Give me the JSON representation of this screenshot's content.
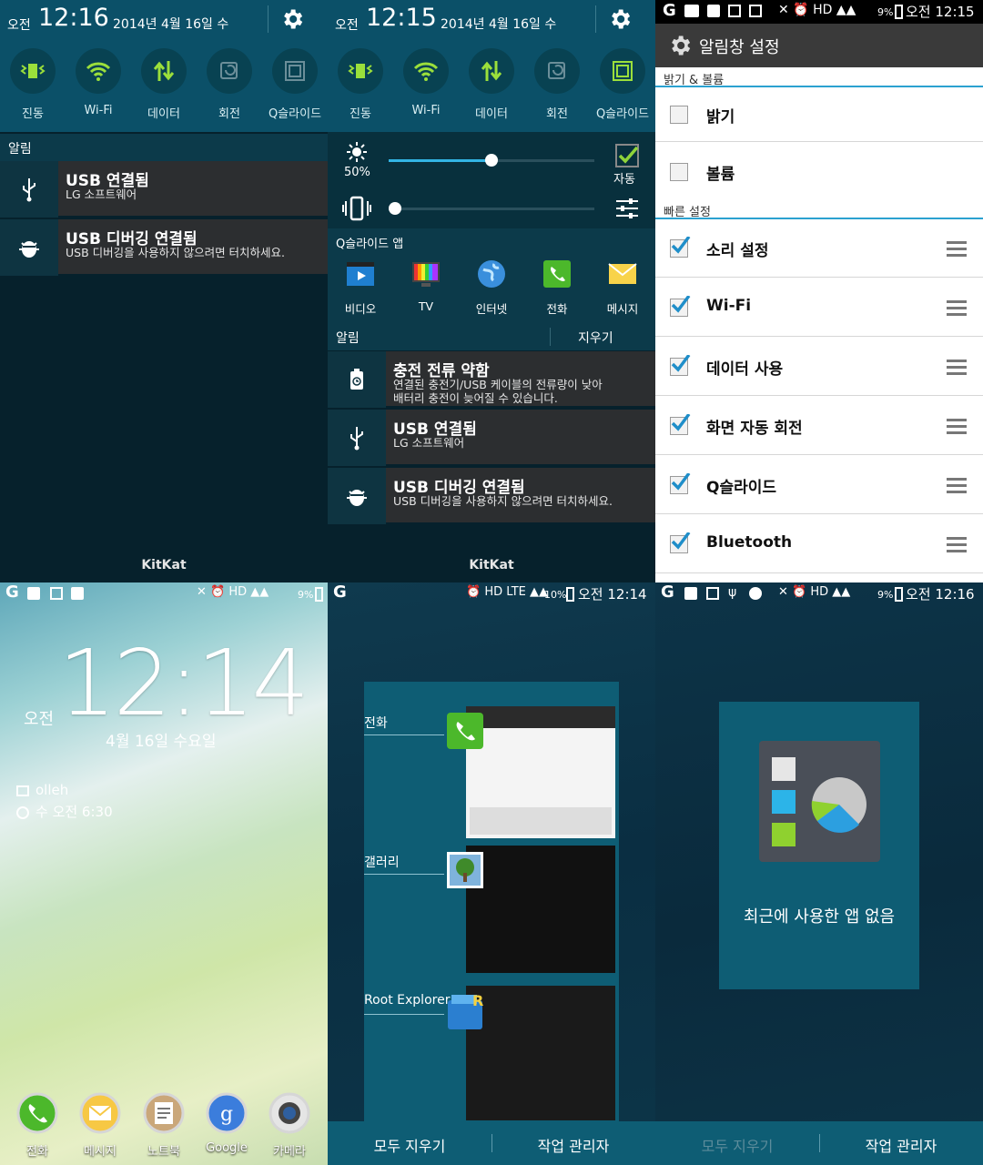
{
  "notif1": {
    "ampm": "오전",
    "time": "12:16",
    "date": "2014년 4월 16일 수",
    "quick": [
      "진동",
      "Wi-Fi",
      "데이터",
      "회전",
      "Q슬라이드"
    ],
    "section": "알림",
    "items": [
      {
        "title": "USB 연결됨",
        "sub": "LG 소프트웨어"
      },
      {
        "title": "USB 디버깅 연결됨",
        "sub": "USB 디버깅을 사용하지 않으려면 터치하세요."
      }
    ],
    "footer": "KitKat"
  },
  "notif2": {
    "ampm": "오전",
    "time": "12:15",
    "date": "2014년 4월 16일 수",
    "quick": [
      "진동",
      "Wi-Fi",
      "데이터",
      "회전",
      "Q슬라이드"
    ],
    "brightness_pct": "50%",
    "brightness_level": 0.5,
    "volume_level": 0.0,
    "auto": "자동",
    "qslide_title": "Q슬라이드 앱",
    "qslide_apps": [
      "비디오",
      "TV",
      "인터넷",
      "전화",
      "메시지"
    ],
    "section": "알림",
    "clear": "지우기",
    "items": [
      {
        "title": "충전 전류 약함",
        "sub": "연결된 충전기/USB 케이블의 전류량이 낮아\n배터리 충전이 늦어질 수 있습니다."
      },
      {
        "title": "USB 연결됨",
        "sub": "LG 소프트웨어"
      },
      {
        "title": "USB 디버깅 연결됨",
        "sub": "USB 디버깅을 사용하지 않으려면 터치하세요."
      }
    ],
    "footer": "KitKat"
  },
  "settings": {
    "status_time": "오전 12:15",
    "battery": "9%",
    "title": "알림창 설정",
    "sections": [
      {
        "header": "밝기 & 볼륨",
        "items": [
          {
            "label": "밝기",
            "checked": false
          },
          {
            "label": "볼륨",
            "checked": false
          }
        ]
      },
      {
        "header": "빠른 설정",
        "items": [
          {
            "label": "소리 설정",
            "checked": true
          },
          {
            "label": "Wi-Fi",
            "checked": true
          },
          {
            "label": "데이터 사용",
            "checked": true
          },
          {
            "label": "화면 자동 회전",
            "checked": true
          },
          {
            "label": "Q슬라이드",
            "checked": true
          },
          {
            "label": "Bluetooth",
            "checked": true
          }
        ]
      }
    ]
  },
  "lock": {
    "battery": "9%",
    "time": "12:14",
    "ampm": "오전",
    "date": "4월 16일 수요일",
    "carrier": "olleh",
    "alarm": "수 오전 6:30",
    "dock": [
      "전화",
      "메시지",
      "노트북",
      "Google",
      "카메라"
    ]
  },
  "recents": {
    "status_time": "오전 12:14",
    "battery": "10%",
    "apps": [
      "전화",
      "갤러리",
      "Root Explorer"
    ],
    "clear_all": "모두 지우기",
    "task_manager": "작업 관리자"
  },
  "recents_empty": {
    "status_time": "오전 12:16",
    "battery": "9%",
    "empty": "최근에 사용한 앱 없음",
    "clear_all": "모두 지우기",
    "task_manager": "작업 관리자"
  }
}
